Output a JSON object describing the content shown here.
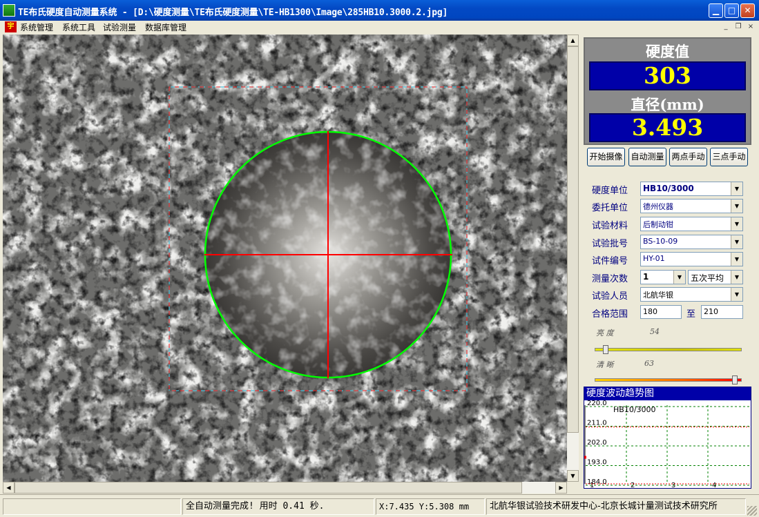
{
  "window": {
    "title": "TE布氏硬度自动测量系统 - [D:\\硬度测量\\TE布氏硬度测量\\TE-HB1300\\Image\\285HB10.3000.2.jpg]",
    "minimize": "▁",
    "maximize": "□",
    "close": "✕"
  },
  "menu": {
    "logo": "宇",
    "items": [
      "系统管理",
      "系统工具",
      "试验测量",
      "数据库管理"
    ]
  },
  "mdi": {
    "minimize": "_",
    "restore": "❐",
    "close": "×"
  },
  "scrollbar": {
    "up": "▲",
    "down": "▼",
    "left": "◀",
    "right": "▶"
  },
  "readout": {
    "hardness_label": "硬度值",
    "hardness_value": "303",
    "diameter_label": "直径(mm)",
    "diameter_value": "3.493"
  },
  "buttons": [
    "开始摄像",
    "自动测量",
    "两点手动",
    "三点手动"
  ],
  "form": {
    "dropdown_arrow": "▼",
    "hardness_unit": {
      "label": "硬度单位",
      "value": "HB10/3000"
    },
    "client": {
      "label": "委托单位",
      "value": "德州仪器"
    },
    "material": {
      "label": "试验材料",
      "value": "后制动钳"
    },
    "batch": {
      "label": "试验批号",
      "value": "BS-10-09"
    },
    "specimen": {
      "label": "试件编号",
      "value": "HY-01"
    },
    "count": {
      "label": "测量次数",
      "value": "1",
      "mode": "五次平均"
    },
    "operator": {
      "label": "试验人员",
      "value": "北航华银"
    },
    "range": {
      "label": "合格范围",
      "min": "180",
      "sep": "至",
      "max": "210"
    }
  },
  "sliders": [
    {
      "label": "亮  度",
      "number": "54",
      "level": 0.06
    },
    {
      "label": "清  晰",
      "number": "63",
      "level": 0.97
    }
  ],
  "trend": {
    "title": "硬度波动趋势图"
  },
  "status": {
    "message": "全自动测量完成! 用时 0.41 秒.",
    "coords": "X:7.435 Y:5.308 mm",
    "credit": "北航华银试验技术研发中心-北京长城计量测试技术研究所"
  },
  "chart_data": {
    "type": "line",
    "title": "硬度波动趋势图",
    "legend": "HB10/3000",
    "categories": [
      "1",
      "2",
      "3",
      "4"
    ],
    "y_ticks": [
      "220.0",
      "211.0",
      "202.0",
      "193.0",
      "184.0"
    ],
    "ylim": [
      184,
      220
    ],
    "limit_lines": [
      210,
      180
    ],
    "series": [],
    "grid": true
  },
  "colors": {
    "title_bar": "#0046c0",
    "readout_bg": "#0000a8",
    "readout_text": "#ffff00",
    "circle": "#00ff00",
    "crosshair": "#ff0000"
  }
}
